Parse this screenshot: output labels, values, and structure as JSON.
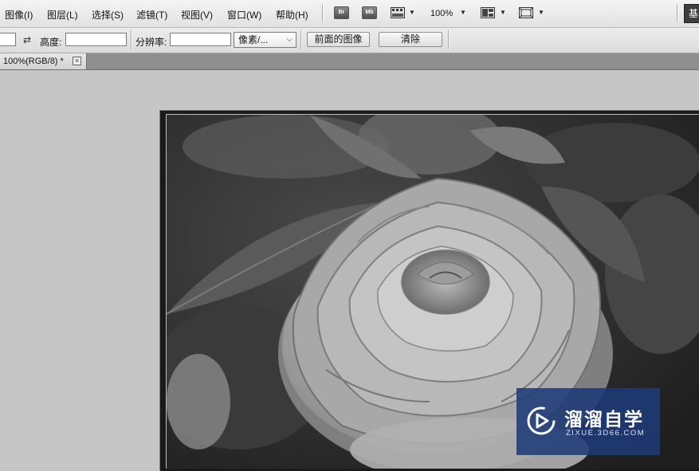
{
  "menu": {
    "items": [
      {
        "label": "图像(I)",
        "name": "menu-image"
      },
      {
        "label": "图层(L)",
        "name": "menu-layer"
      },
      {
        "label": "选择(S)",
        "name": "menu-select"
      },
      {
        "label": "滤镜(T)",
        "name": "menu-filter"
      },
      {
        "label": "视图(V)",
        "name": "menu-view"
      },
      {
        "label": "窗口(W)",
        "name": "menu-window"
      },
      {
        "label": "帮助(H)",
        "name": "menu-help"
      }
    ],
    "bridge_label": "Br",
    "minibridge_label": "Mb",
    "zoom_value": "100%",
    "workspace_label": "基"
  },
  "options": {
    "width_value": "",
    "swap_icon": "⇄",
    "height_label": "高度:",
    "height_value": "",
    "resolution_label": "分辨率:",
    "resolution_value": "",
    "unit_select": "像素/...",
    "front_image_button": "前面的图像",
    "clear_button": "清除"
  },
  "document": {
    "tab_label": "100%(RGB/8) *",
    "close_label": "×"
  },
  "watermark": {
    "title": "溜溜自学",
    "url": "ZIXUE.3D66.COM"
  },
  "colors": {
    "canvas_bg": "#c6c6c6",
    "watermark_bg": "#1e3a78"
  }
}
